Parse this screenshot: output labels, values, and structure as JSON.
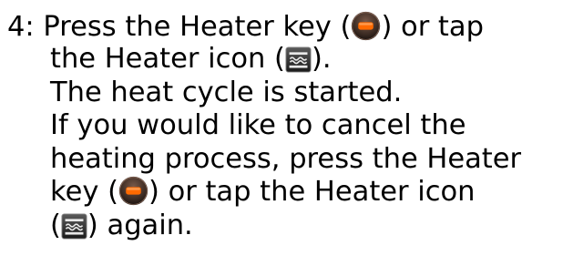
{
  "step": {
    "number": "4:",
    "line1_a": "Press the Heater key (",
    "line1_b": ") or tap",
    "line2_a": "the Heater icon (",
    "line2_b": ").",
    "line3": "The heat cycle is started.",
    "line4": "If you would like to cancel the",
    "line5": "heating process, press the Heater",
    "line6_a": "key (",
    "line6_b": ") or tap the Heater icon",
    "line7_a": "(",
    "line7_b": ") again."
  },
  "icons": {
    "heater_key": "heater-key-icon",
    "heater_icon": "heater-icon"
  },
  "colors": {
    "key_orange": "#ff6a00",
    "key_dark": "#3a2a22",
    "icon_dark": "#2b2b2b"
  }
}
